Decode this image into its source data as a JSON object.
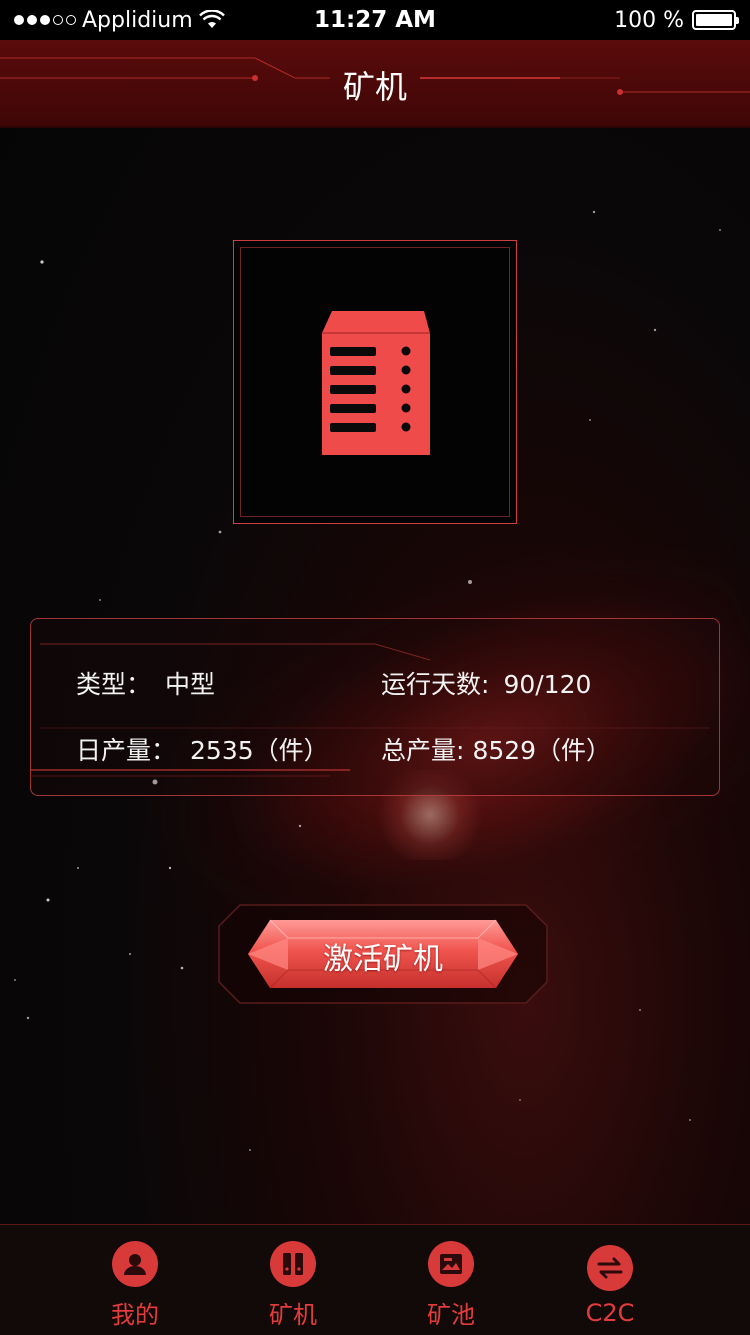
{
  "status_bar": {
    "carrier": "Applidium",
    "time": "11:27 AM",
    "battery": "100 %"
  },
  "header": {
    "title": "矿机"
  },
  "miner": {
    "icon": "server-icon",
    "color": "#f04b4b"
  },
  "info": {
    "type_label": "类型：",
    "type_value": "中型",
    "days_label": "运行天数:",
    "days_value": "90/120",
    "daily_label": "日产量：",
    "daily_value": "2535（件）",
    "total_label": "总产量:",
    "total_value": "8529（件）"
  },
  "activate_button": {
    "label": "激活矿机"
  },
  "tabs": [
    {
      "label": "我的",
      "icon": "user-icon"
    },
    {
      "label": "矿机",
      "icon": "miner-icon"
    },
    {
      "label": "矿池",
      "icon": "pool-icon"
    },
    {
      "label": "C2C",
      "icon": "exchange-icon"
    }
  ],
  "colors": {
    "accent": "#e23c3c",
    "header_bg": "#4a0808",
    "panel_border": "#d24646"
  }
}
